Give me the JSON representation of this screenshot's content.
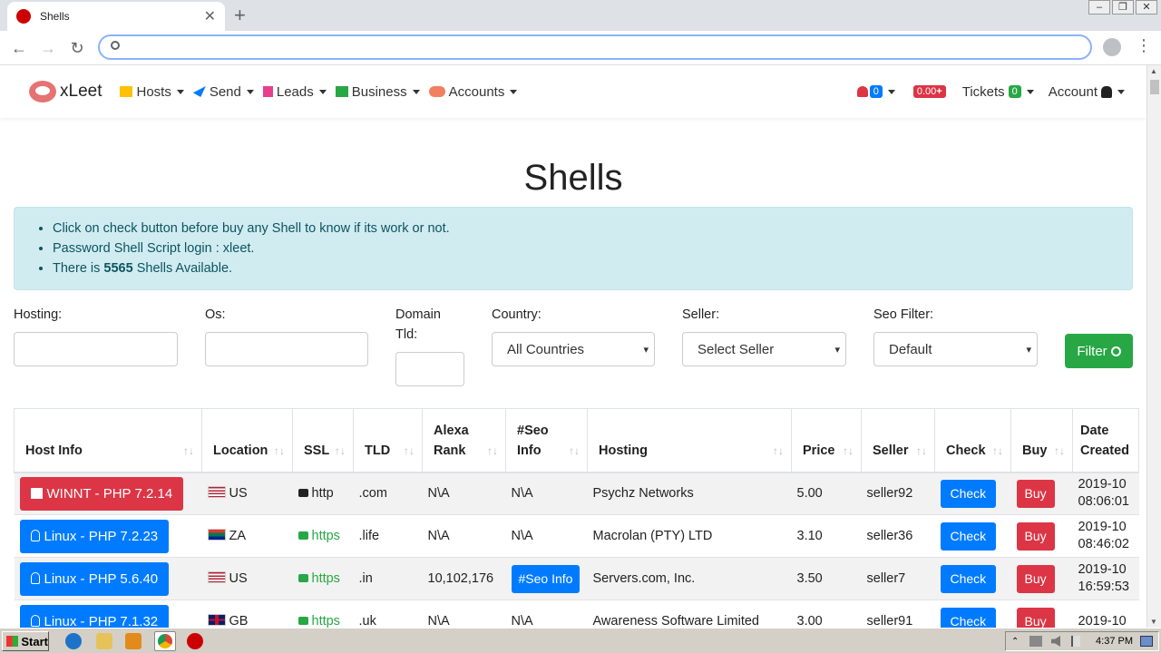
{
  "browser": {
    "tab_title": "Shells",
    "close_glyph": "✕",
    "newtab_glyph": "+",
    "omnibox_value": ""
  },
  "site": {
    "brand": "xLeet",
    "nav": [
      {
        "label": "Hosts",
        "color": "#ffc107"
      },
      {
        "label": "Send",
        "color": "#007bff"
      },
      {
        "label": "Leads",
        "color": "#e83e8c"
      },
      {
        "label": "Business",
        "color": "#28a745"
      },
      {
        "label": "Accounts",
        "color": "#f08060"
      }
    ],
    "notifications_count": "0",
    "balance": "0.00",
    "balance_plus": "+",
    "tickets_label": "Tickets",
    "tickets_count": "0",
    "account_label": "Account"
  },
  "page": {
    "title": "Shells",
    "notices": {
      "line1": "Click on check button before buy any Shell to know if its work or not.",
      "line2": "Password Shell Script login : xleet.",
      "line3_prefix": "There is ",
      "line3_count": "5565",
      "line3_suffix": " Shells Available."
    },
    "filters": {
      "hosting_label": "Hosting:",
      "os_label": "Os:",
      "tld_label": "Domain Tld:",
      "country_label": "Country:",
      "country_value": "All Countries",
      "seller_label": "Seller:",
      "seller_value": "Select Seller",
      "seo_label": "Seo Filter:",
      "seo_value": "Default",
      "button": "Filter"
    }
  },
  "table": {
    "headers": [
      "Host Info",
      "Location",
      "SSL",
      "TLD",
      "Alexa Rank",
      "#Seo Info",
      "Hosting",
      "Price",
      "Seller",
      "Check",
      "Buy",
      "Date Created"
    ],
    "rows": [
      {
        "host": "WINNT - PHP 7.2.14",
        "os": "windows",
        "location": "US",
        "ssl": "http",
        "tld": ".com",
        "alexa": "N\\A",
        "seo": "N\\A",
        "hosting": "Psychz Networks",
        "price": "5.00",
        "seller": "seller92",
        "check": "Check",
        "buy": "Buy",
        "date1": "2019-10",
        "date2": "08:06:01"
      },
      {
        "host": "Linux - PHP 7.2.23",
        "os": "linux",
        "location": "ZA",
        "ssl": "https",
        "tld": ".life",
        "alexa": "N\\A",
        "seo": "N\\A",
        "hosting": "Macrolan (PTY) LTD",
        "price": "3.10",
        "seller": "seller36",
        "check": "Check",
        "buy": "Buy",
        "date1": "2019-10",
        "date2": "08:46:02"
      },
      {
        "host": "Linux - PHP 5.6.40",
        "os": "linux",
        "location": "US",
        "ssl": "https",
        "tld": ".in",
        "alexa": "10,102,176",
        "seo": "#Seo Info",
        "hosting": "Servers.com, Inc.",
        "price": "3.50",
        "seller": "seller7",
        "check": "Check",
        "buy": "Buy",
        "date1": "2019-10",
        "date2": "16:59:53"
      },
      {
        "host": "Linux - PHP 7.1.32",
        "os": "linux",
        "location": "GB",
        "ssl": "https",
        "tld": ".uk",
        "alexa": "N\\A",
        "seo": "N\\A",
        "hosting": "Awareness Software Limited",
        "price": "3.00",
        "seller": "seller91",
        "check": "Check",
        "buy": "Buy",
        "date1": "2019-10",
        "date2": ""
      }
    ]
  },
  "taskbar": {
    "start": "Start",
    "clock": "4:37 PM"
  }
}
